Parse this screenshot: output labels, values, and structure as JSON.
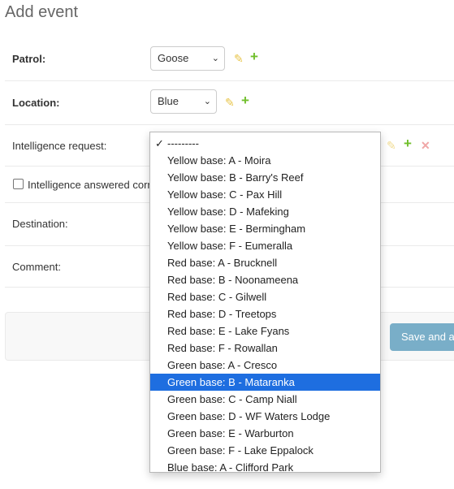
{
  "title": "Add event",
  "fields": {
    "patrol": {
      "label": "Patrol:",
      "value": "Goose"
    },
    "location": {
      "label": "Location:",
      "value": "Blue"
    },
    "intelligence_request": {
      "label": "Intelligence request:"
    },
    "intelligence_answered": {
      "label": "Intelligence answered corr"
    },
    "destination": {
      "label": "Destination:"
    },
    "comment": {
      "label": "Comment:"
    }
  },
  "submit": {
    "save_label": "Save and ac"
  },
  "dropdown": {
    "selected": "Green base: B - Mataranka",
    "options": [
      "---------",
      "Yellow base: A - Moira",
      "Yellow base: B - Barry's Reef",
      "Yellow base: C - Pax Hill",
      "Yellow base: D - Mafeking",
      "Yellow base: E - Bermingham",
      "Yellow base: F - Eumeralla",
      "Red base: A - Brucknell",
      "Red base: B - Noonameena",
      "Red base: C - Gilwell",
      "Red base: D - Treetops",
      "Red base: E - Lake Fyans",
      "Red base: F - Rowallan",
      "Green base: A - Cresco",
      "Green base: B - Mataranka",
      "Green base: C - Camp Niall",
      "Green base: D - WF Waters Lodge",
      "Green base: E - Warburton",
      "Green base: F - Lake Eppalock",
      "Blue base: A - Clifford Park"
    ],
    "checked_index": 0
  },
  "colors": {
    "save_button": "#79aec8",
    "highlight": "#1e6ee0",
    "add_icon": "#70bf2b",
    "edit_icon": "#e8c54a",
    "delete_icon": "#f0a7a7"
  },
  "icons": {
    "edit": "pencil-icon",
    "add": "plus-icon",
    "delete": "close-icon",
    "select": "chevron-down-icon"
  }
}
